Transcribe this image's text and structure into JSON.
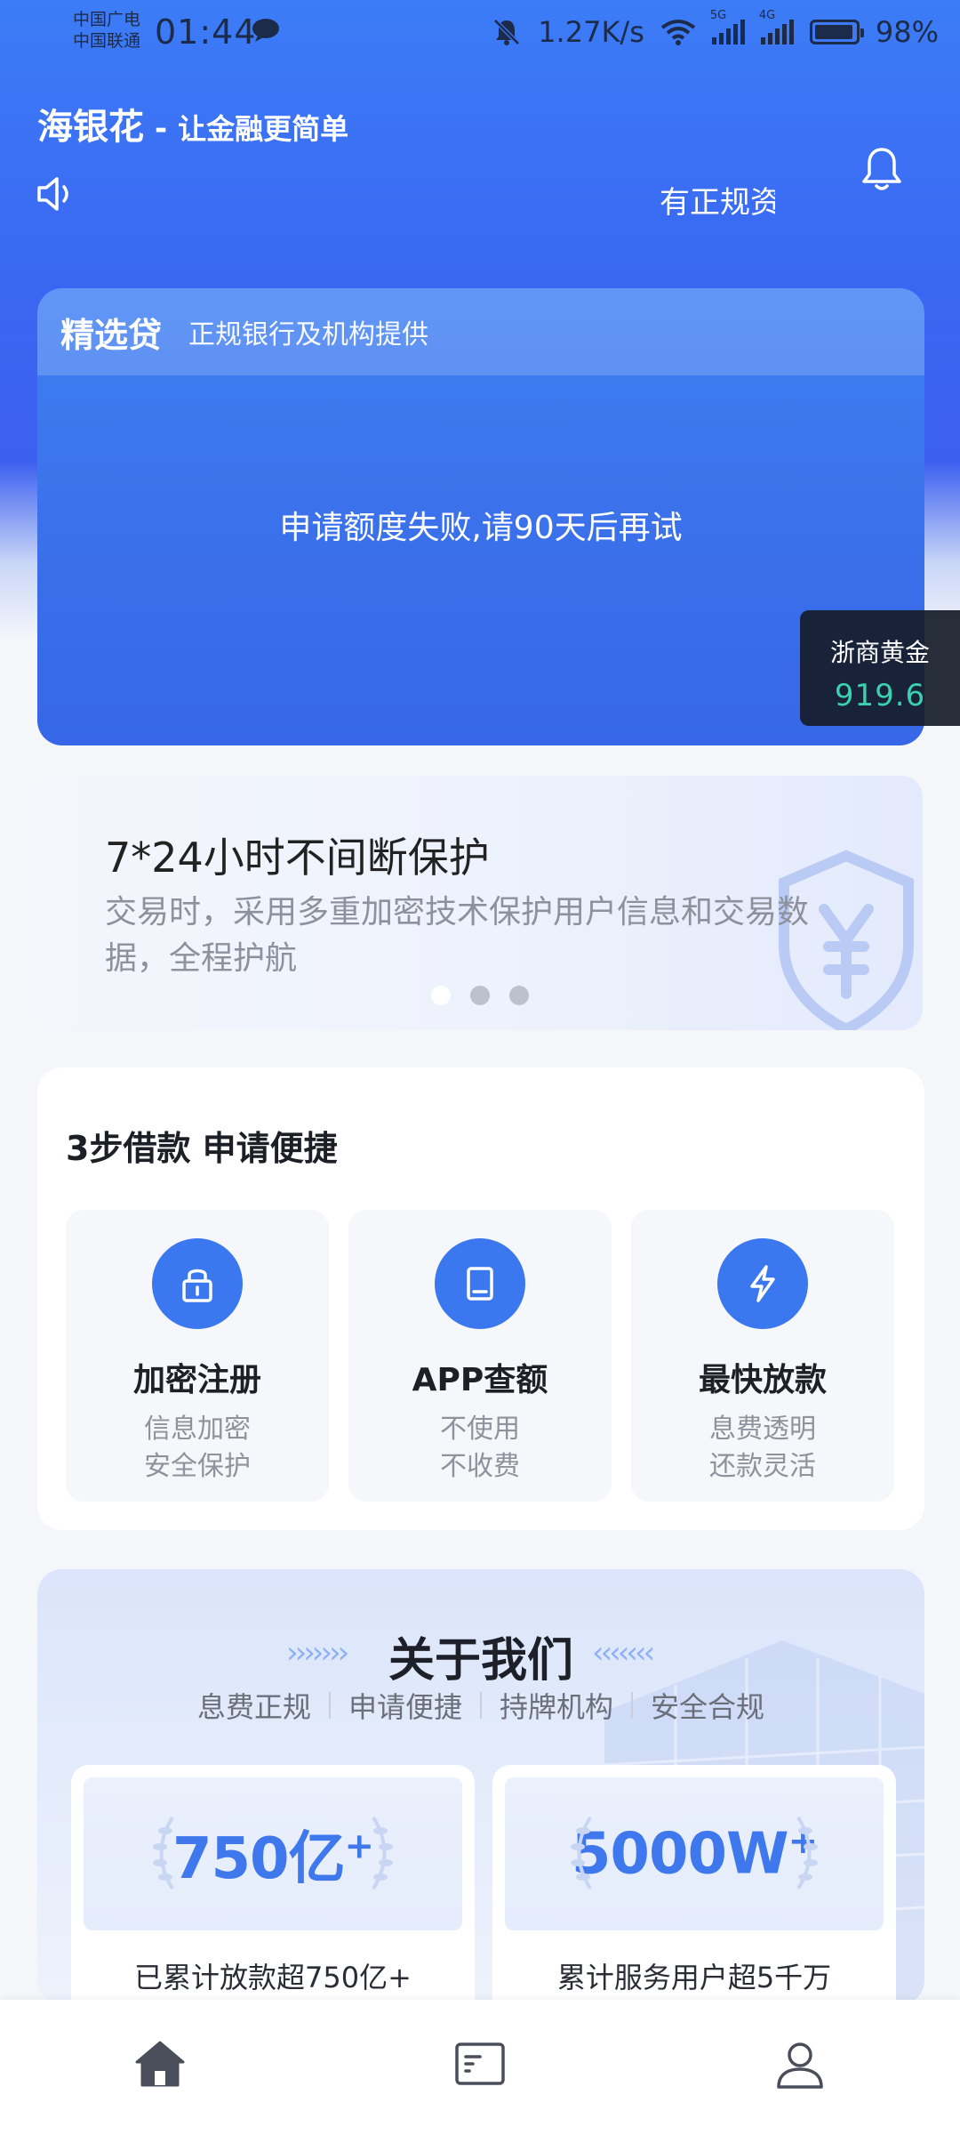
{
  "status_bar": {
    "carrier_1": "中国广电",
    "carrier_2": "中国联通",
    "time": "01:44",
    "net_speed": "1.27K/s",
    "net_5g": "5G",
    "net_4g": "4G",
    "battery": "98%"
  },
  "header": {
    "app_name": "海银花",
    "dash": "-",
    "slogan": "让金融更简单",
    "marquee_text": "有正规资",
    "icons": [
      "speaker-icon",
      "bell-icon"
    ]
  },
  "loan_card": {
    "title": "精选贷",
    "subtitle": "正规银行及机构提供",
    "message": "申请额度失败,请90天后再试"
  },
  "gold_widget": {
    "name": "浙商黄金",
    "price": "919.6"
  },
  "protection_banner": {
    "title": "7*24小时不间断保护",
    "description": "交易时，采用多重加密技术保护用户信息和交易数据，全程护航",
    "pages": 3,
    "active_page": 1
  },
  "steps": {
    "title": "3步借款 申请便捷",
    "items": [
      {
        "name": "加密注册",
        "line1": "信息加密",
        "line2": "安全保护",
        "icon": "lock-icon"
      },
      {
        "name": "APP查额",
        "line1": "不使用",
        "line2": "不收费",
        "icon": "tablet-icon"
      },
      {
        "name": "最快放款",
        "line1": "息费透明",
        "line2": "还款灵活",
        "icon": "lightning-icon"
      }
    ]
  },
  "about": {
    "title": "关于我们",
    "tags": [
      "息费正规",
      "申请便捷",
      "持牌机构",
      "安全合规"
    ],
    "stats": [
      {
        "value": "750亿",
        "plus": "+",
        "caption": "已累计放款超750亿+"
      },
      {
        "value": "5000W",
        "plus": "+",
        "caption": "累计服务用户超5千万"
      }
    ]
  },
  "bottom_nav": {
    "items": [
      "home-icon",
      "list-icon",
      "profile-icon"
    ],
    "active": "home-icon",
    "colors": {
      "active": "#4a4e5a",
      "inactive": "#4a4e5a"
    }
  },
  "colors": {
    "primary": "#3b78f0",
    "gold_price": "#3ad0b0"
  }
}
